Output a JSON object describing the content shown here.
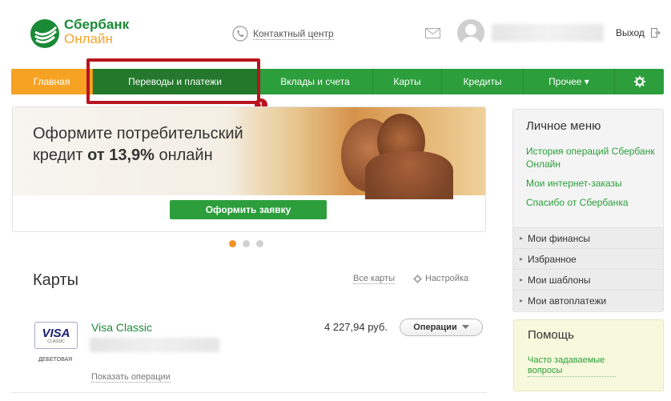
{
  "header": {
    "logo_line1": "Сбербанк",
    "logo_line2": "Онлайн",
    "contact_center": "Контактный центр",
    "logout": "Выход"
  },
  "nav": {
    "items": [
      {
        "label": "Главная"
      },
      {
        "label": "Переводы и платежи"
      },
      {
        "label": "Вклады и счета"
      },
      {
        "label": "Карты"
      },
      {
        "label": "Кредиты"
      },
      {
        "label": "Прочее ▾"
      }
    ],
    "highlight_badge": "1"
  },
  "banner": {
    "title_line1": "Оформите потребительский",
    "title_line2_prefix": "кредит ",
    "title_line2_bold": "от 13,9%",
    "title_line2_suffix": " онлайн",
    "button": "Оформить заявку",
    "slides_total": 3,
    "active_slide": 1
  },
  "cards_section": {
    "title": "Карты",
    "all_cards": "Все карты",
    "settings": "Настройка",
    "card": {
      "logo_text": "VISA",
      "logo_subtext": "CLASSIC",
      "type_label": "ДЕБЕТОВАЯ",
      "name": "Visa Classic",
      "amount": "4 227,94 руб.",
      "operations_button": "Операции",
      "show_operations": "Показать операции"
    }
  },
  "side_menu": {
    "title": "Личное меню",
    "links": [
      "История операций Сбербанк Онлайн",
      "Мои интернет-заказы",
      "Спасибо от Сбербанка"
    ],
    "rows": [
      "Мои финансы",
      "Избранное",
      "Мои шаблоны",
      "Мои автоплатежи"
    ]
  },
  "help": {
    "title": "Помощь",
    "link": "Часто задаваемые вопросы"
  },
  "colors": {
    "brand_green": "#2c9e3c",
    "active_green": "#23782c",
    "home_orange": "#f6a324",
    "highlight_red": "#b8141f"
  }
}
